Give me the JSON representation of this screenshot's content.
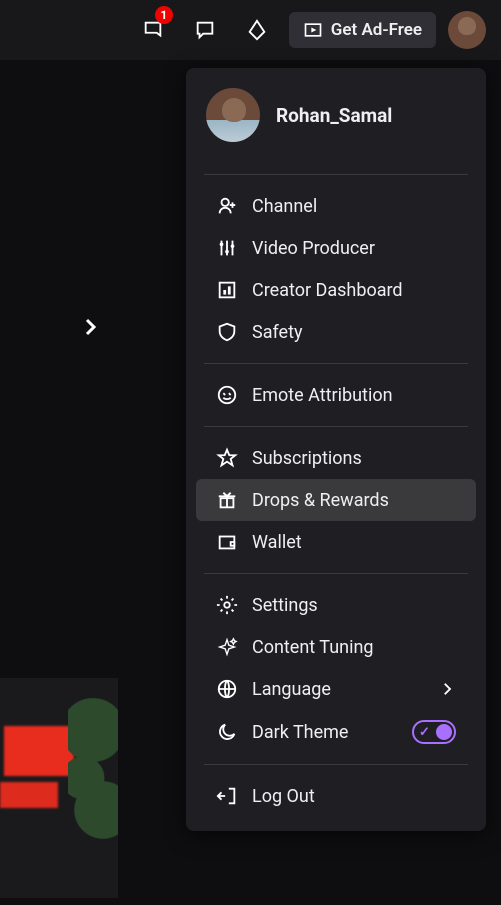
{
  "topbar": {
    "notification_count": "1",
    "ad_free_label": "Get Ad-Free"
  },
  "user": {
    "username": "Rohan_Samal"
  },
  "menu": {
    "section1": [
      {
        "label": "Channel",
        "icon": "user-icon"
      },
      {
        "label": "Video Producer",
        "icon": "sliders-icon"
      },
      {
        "label": "Creator Dashboard",
        "icon": "dashboard-icon"
      },
      {
        "label": "Safety",
        "icon": "shield-icon"
      }
    ],
    "section2": [
      {
        "label": "Emote Attribution",
        "icon": "emote-icon"
      }
    ],
    "section3": [
      {
        "label": "Subscriptions",
        "icon": "star-icon"
      },
      {
        "label": "Drops & Rewards",
        "icon": "gift-icon",
        "hovered": true
      },
      {
        "label": "Wallet",
        "icon": "wallet-icon"
      }
    ],
    "section4": [
      {
        "label": "Settings",
        "icon": "gear-icon"
      },
      {
        "label": "Content Tuning",
        "icon": "sparkle-icon"
      },
      {
        "label": "Language",
        "icon": "globe-icon",
        "chevron": true
      },
      {
        "label": "Dark Theme",
        "icon": "moon-icon",
        "toggle": true,
        "toggle_on": true
      }
    ],
    "section5": [
      {
        "label": "Log Out",
        "icon": "logout-icon"
      }
    ]
  }
}
